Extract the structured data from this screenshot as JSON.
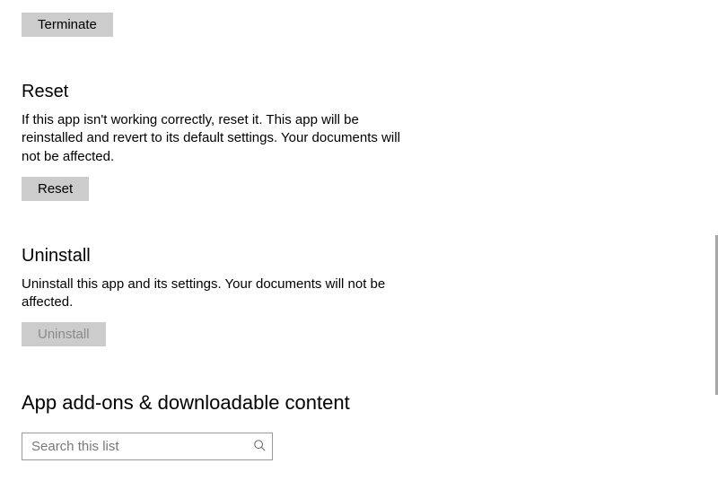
{
  "terminate": {
    "label": "Terminate"
  },
  "reset": {
    "heading": "Reset",
    "description": "If this app isn't working correctly, reset it. This app will be reinstalled and revert to its default settings. Your documents will not be affected.",
    "label": "Reset"
  },
  "uninstall": {
    "heading": "Uninstall",
    "description": "Uninstall this app and its settings. Your documents will not be affected.",
    "label": "Uninstall"
  },
  "addons": {
    "heading": "App add-ons & downloadable content"
  },
  "search": {
    "placeholder": "Search this list"
  }
}
